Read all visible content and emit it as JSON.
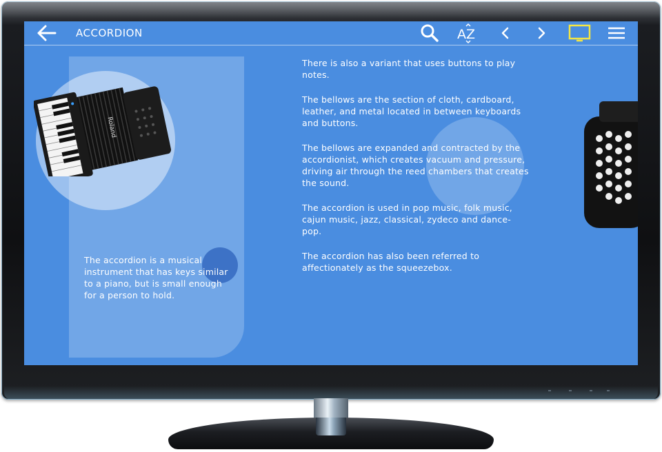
{
  "header": {
    "back_icon": "arrow-left-icon",
    "title": "ACCORDION",
    "buttons": [
      {
        "name": "search",
        "icon": "search-icon"
      },
      {
        "name": "sort",
        "icon": "sort-az-icon",
        "label": "AZ"
      },
      {
        "name": "previous",
        "icon": "chevron-left-icon"
      },
      {
        "name": "next",
        "icon": "chevron-right-icon"
      },
      {
        "name": "display",
        "icon": "monitor-icon",
        "accent": "#f5e642"
      },
      {
        "name": "menu",
        "icon": "hamburger-menu-icon"
      }
    ]
  },
  "instrument": {
    "brand_label": "Roland",
    "intro": "The accordion is a musical instrument that has keys similar to a piano, but is small enough for a person to hold."
  },
  "facts": [
    "There is also a variant that uses buttons to play notes.",
    "The bellows are the section of cloth, cardboard, leather, and metal located in between keyboards and buttons.",
    "The bellows are expanded and contracted by the accordionist, which creates vacuum and pressure, driving air through the reed chambers that creates the sound.",
    "The accordion is used in pop music, folk music, cajun music, jazz, classical, zydeco and dance-pop.",
    "The accordion has also been referred to affectionately as the squeezebox."
  ],
  "colors": {
    "screen_background": "#4a8de0",
    "accent": "#f5e642",
    "text": "#ffffff"
  }
}
